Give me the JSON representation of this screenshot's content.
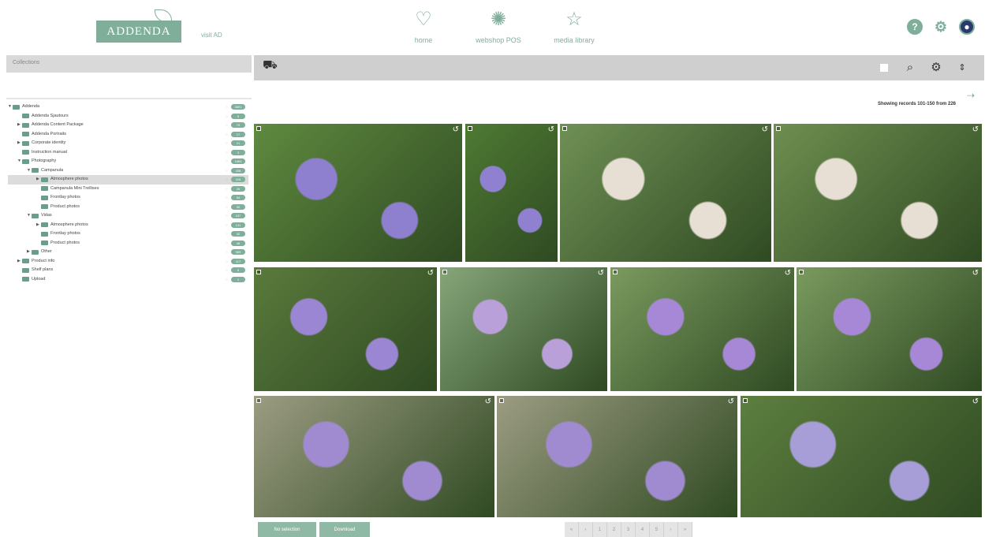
{
  "header": {
    "logo_text": "ADDENDA",
    "sublink": "visit AD",
    "nav": [
      {
        "label": "home",
        "icon": "heart-icon"
      },
      {
        "label": "webshop POS",
        "icon": "bee-icon"
      },
      {
        "label": "media library",
        "icon": "star-icon"
      }
    ],
    "right_icons": [
      "help-icon",
      "settings-icon",
      "user-avatar-icon"
    ]
  },
  "sidebar": {
    "search_label": "Collections",
    "tree": [
      {
        "label": "Addenda",
        "depth": 0,
        "toggle": "▼",
        "count": "3891"
      },
      {
        "label": "Addenda Sjautours",
        "depth": 1,
        "toggle": "",
        "count": "5"
      },
      {
        "label": "Addenda Content Package",
        "depth": 1,
        "toggle": "▶",
        "count": "79"
      },
      {
        "label": "Addenda Portraits",
        "depth": 1,
        "toggle": "",
        "count": "17"
      },
      {
        "label": "Corporate identity",
        "depth": 1,
        "toggle": "▶",
        "count": "21"
      },
      {
        "label": "Instruction manual",
        "depth": 1,
        "toggle": "",
        "count": "3"
      },
      {
        "label": "Photography",
        "depth": 1,
        "toggle": "▼",
        "count": "1664"
      },
      {
        "label": "Campanula",
        "depth": 2,
        "toggle": "▼",
        "count": "438"
      },
      {
        "label": "Atmosphere photos",
        "depth": 3,
        "toggle": "▶",
        "count": "226",
        "selected": true
      },
      {
        "label": "Campanula Mini Trellises",
        "depth": 3,
        "toggle": "",
        "count": "26"
      },
      {
        "label": "Frontlay photos",
        "depth": 3,
        "toggle": "",
        "count": "64"
      },
      {
        "label": "Product photos",
        "depth": 3,
        "toggle": "",
        "count": "90"
      },
      {
        "label": "Vidas",
        "depth": 2,
        "toggle": "▼",
        "count": "247"
      },
      {
        "label": "Atmosphere photos",
        "depth": 3,
        "toggle": "▶",
        "count": "131"
      },
      {
        "label": "Frontlay photos",
        "depth": 3,
        "toggle": "",
        "count": "32"
      },
      {
        "label": "Product photos",
        "depth": 3,
        "toggle": "",
        "count": "48"
      },
      {
        "label": "Other",
        "depth": 2,
        "toggle": "▶",
        "count": "989"
      },
      {
        "label": "Product info",
        "depth": 1,
        "toggle": "▶",
        "count": "117"
      },
      {
        "label": "Shelf plans",
        "depth": 1,
        "toggle": "",
        "count": "6"
      },
      {
        "label": "Upload",
        "depth": 1,
        "toggle": "",
        "count": "2"
      }
    ]
  },
  "toolbar": {
    "left_icon": "basket-icon",
    "right_icons": [
      "search-icon",
      "gear-icon",
      "sort-icon"
    ]
  },
  "records_text": "Showing records 101-150 from 226",
  "buttons": {
    "select": "No selection",
    "download": "Download"
  },
  "pager": [
    "«",
    "‹",
    "1",
    "2",
    "3",
    "4",
    "5",
    "›",
    "»"
  ],
  "colors": {
    "accent": "#7fae9b",
    "toolbar": "#cfcfcf"
  }
}
